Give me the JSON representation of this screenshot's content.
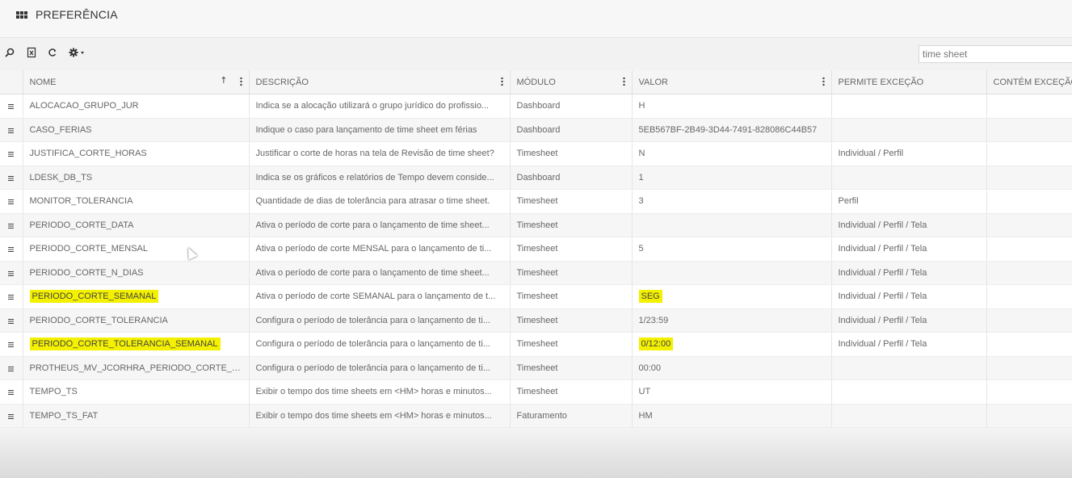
{
  "header": {
    "title": "PREFERÊNCIA"
  },
  "toolbar": {
    "icons": [
      "search-icon",
      "export-excel-icon",
      "refresh-icon",
      "settings-dropdown-icon"
    ],
    "search_value": "time sheet"
  },
  "table": {
    "columns": [
      "NOME",
      "DESCRIÇÃO",
      "MÓDULO",
      "VALOR",
      "PERMITE EXCEÇÃO",
      "CONTÉM EXCEÇÃO"
    ],
    "rows": [
      {
        "nome": "ALOCACAO_GRUPO_JUR",
        "descricao": "Indica se a alocação utilizará o grupo jurídico do profissio...",
        "modulo": "Dashboard",
        "valor": "H",
        "permite": "",
        "contem": ""
      },
      {
        "nome": "CASO_FERIAS",
        "descricao": "Indique o caso para lançamento de time sheet em férias",
        "modulo": "Dashboard",
        "valor": "5EB567BF-2B49-3D44-7491-828086C44B57",
        "permite": "",
        "contem": ""
      },
      {
        "nome": "JUSTIFICA_CORTE_HORAS",
        "descricao": "Justificar o corte de horas na tela de Revisão de time sheet?",
        "modulo": "Timesheet",
        "valor": "N",
        "permite": "Individual / Perfil",
        "contem": ""
      },
      {
        "nome": "LDESK_DB_TS",
        "descricao": "Indica se os gráficos e relatórios de Tempo devem conside...",
        "modulo": "Dashboard",
        "valor": "1",
        "permite": "",
        "contem": ""
      },
      {
        "nome": "MONITOR_TOLERANCIA",
        "descricao": "Quantidade de dias de tolerância para atrasar o time sheet.",
        "modulo": "Timesheet",
        "valor": "3",
        "permite": "Perfil",
        "contem": ""
      },
      {
        "nome": "PERIODO_CORTE_DATA",
        "descricao": "Ativa o período de corte para o lançamento de time sheet...",
        "modulo": "Timesheet",
        "valor": "",
        "permite": "Individual / Perfil / Tela",
        "contem": ""
      },
      {
        "nome": "PERIODO_CORTE_MENSAL",
        "descricao": "Ativa o período de corte MENSAL para o lançamento de ti...",
        "modulo": "Timesheet",
        "valor": "5",
        "permite": "Individual / Perfil / Tela",
        "contem": ""
      },
      {
        "nome": "PERIODO_CORTE_N_DIAS",
        "descricao": "Ativa o período de corte para o lançamento de time sheet...",
        "modulo": "Timesheet",
        "valor": "",
        "permite": "Individual / Perfil / Tela",
        "contem": ""
      },
      {
        "nome": "PERIODO_CORTE_SEMANAL",
        "descricao": "Ativa o período de corte SEMANAL para o lançamento de t...",
        "modulo": "Timesheet",
        "valor": "SEG",
        "permite": "Individual / Perfil / Tela",
        "contem": "",
        "highlight": true
      },
      {
        "nome": "PERIODO_CORTE_TOLERANCIA",
        "descricao": "Configura o período de tolerância para o lançamento de ti...",
        "modulo": "Timesheet",
        "valor": "1/23:59",
        "permite": "Individual / Perfil / Tela",
        "contem": ""
      },
      {
        "nome": "PERIODO_CORTE_TOLERANCIA_SEMANAL",
        "descricao": "Configura o período de tolerância para o lançamento de ti...",
        "modulo": "Timesheet",
        "valor": "0/12:00",
        "permite": "Individual / Perfil / Tela",
        "contem": "",
        "highlight": true
      },
      {
        "nome": "PROTHEUS_MV_JCORHRA_PERIODO_CORTE_TOLE...",
        "descricao": "Configura o período de tolerância para o lançamento de ti...",
        "modulo": "Timesheet",
        "valor": "00:00",
        "permite": "",
        "contem": ""
      },
      {
        "nome": "TEMPO_TS",
        "descricao": "Exibir o tempo dos time sheets em <HM> horas e minutos...",
        "modulo": "Timesheet",
        "valor": "UT",
        "permite": "",
        "contem": ""
      },
      {
        "nome": "TEMPO_TS_FAT",
        "descricao": "Exibir o tempo dos time sheets em <HM> horas e minutos...",
        "modulo": "Faturamento",
        "valor": "HM",
        "permite": "",
        "contem": ""
      }
    ]
  }
}
